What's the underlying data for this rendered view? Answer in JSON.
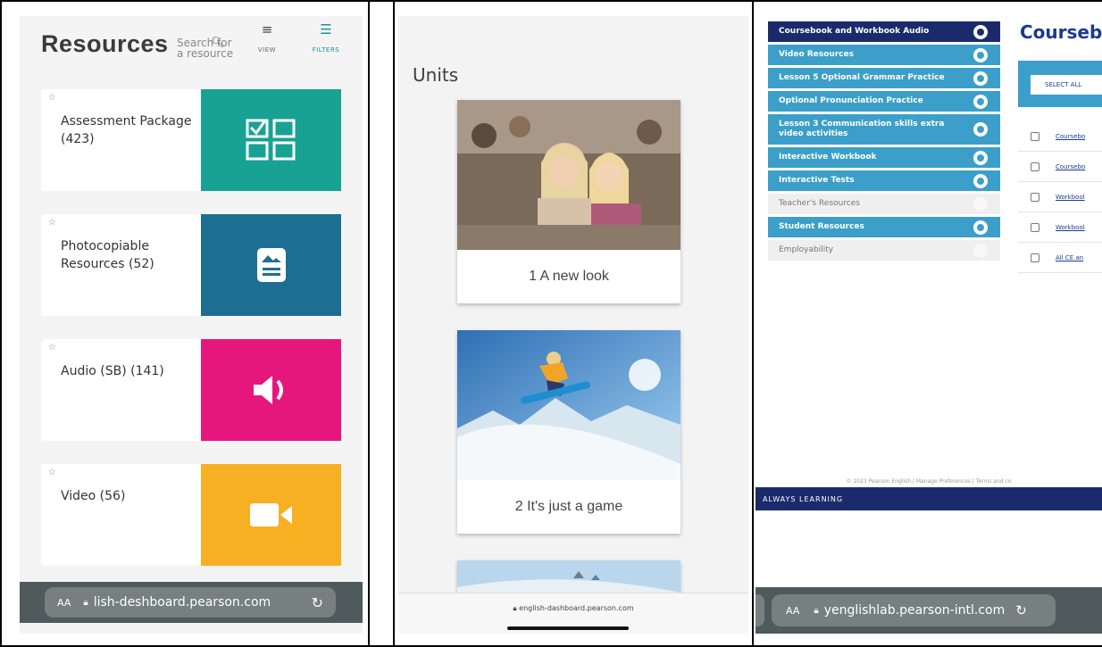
{
  "panel1": {
    "title": "Resources",
    "search_placeholder": "Search for a resource",
    "view_label": "VIEW",
    "filters_label": "FILTERS",
    "cards": [
      {
        "label": "Assessment Package (423)",
        "color": "#18a294",
        "icon": "checklist-grid-icon"
      },
      {
        "label": "Photocopiable Resources (52)",
        "color": "#1d6f92",
        "icon": "document-image-icon"
      },
      {
        "label": "Audio (SB) (141)",
        "color": "#e6177c",
        "icon": "speaker-icon"
      },
      {
        "label": "Video (56)",
        "color": "#f7b022",
        "icon": "video-camera-icon"
      }
    ],
    "url_aa": "AA",
    "url": "lish-deshboard.pearson.com"
  },
  "panel2": {
    "heading": "Units",
    "units": [
      {
        "caption": "1 A new look"
      },
      {
        "caption": "2 It's just a game"
      }
    ],
    "url": "english-dashboard.pearson.com"
  },
  "panel3": {
    "title": "Coursebo",
    "nav": [
      {
        "label": "Coursebook and Workbook Audio",
        "style": "dark"
      },
      {
        "label": "Video Resources",
        "style": "blue"
      },
      {
        "label": "Lesson 5 Optional Grammar Practice",
        "style": "blue"
      },
      {
        "label": "Optional Pronunciation Practice",
        "style": "blue"
      },
      {
        "label": "Lesson 3 Communication skills extra video activities",
        "style": "blue"
      },
      {
        "label": "Interactive Workbook",
        "style": "blue"
      },
      {
        "label": "Interactive Tests",
        "style": "blue"
      },
      {
        "label": "Teacher's Resources",
        "style": "grey"
      },
      {
        "label": "Student Resources",
        "style": "blue"
      },
      {
        "label": "Employability",
        "style": "grey"
      }
    ],
    "select_all": "SELECT ALL",
    "list": [
      "Coursebo",
      "Coursebo",
      "Workbool",
      "Workbool",
      "All CE an"
    ],
    "footer": "© 2023 Pearson English  |  Manage Preferences  |  Terms and co",
    "band": "ALWAYS LEARNING",
    "url_aa": "AA",
    "url": "yenglishlab.pearson-intl.com"
  }
}
